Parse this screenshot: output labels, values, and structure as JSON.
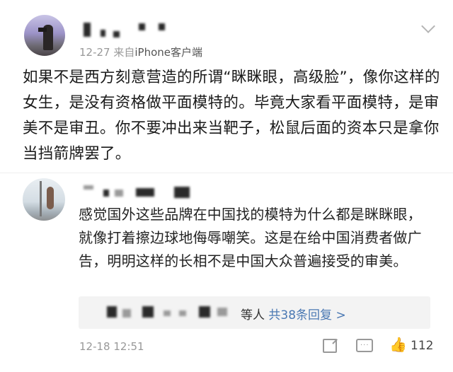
{
  "post1": {
    "meta": {
      "time": "12-27",
      "source_prefix": "来自",
      "source": "iPhone客户端"
    },
    "text": "如果不是西方刻意营造的所谓“眯眯眼，高级脸”，像你这样的女生，是没有资格做平面模特的。毕竟大家看平面模特，是审美不是审丑。你不要冲出来当靶子，松鼠后面的资本只是拿你当挡箭牌罢了。"
  },
  "comment": {
    "text": "感觉国外这些品牌在中国找的模特为什么都是眯眯眼，就像打着擦边球地侮辱嘲笑。这是在给中国消费者做广告，明明这样的长相不是中国大众普遍接受的审美。",
    "reply_summary": {
      "suffix": "等人",
      "link": "共38条回复 >"
    },
    "time": "12-18 12:51",
    "likes": "112"
  },
  "icons": {
    "expand": "chevron-down-icon",
    "share": "share-icon",
    "comment": "comment-icon",
    "like": "thumbs-up-icon"
  },
  "colors": {
    "link": "#4a78b3",
    "muted": "#999999",
    "reply_bg": "#f3f3f3"
  }
}
